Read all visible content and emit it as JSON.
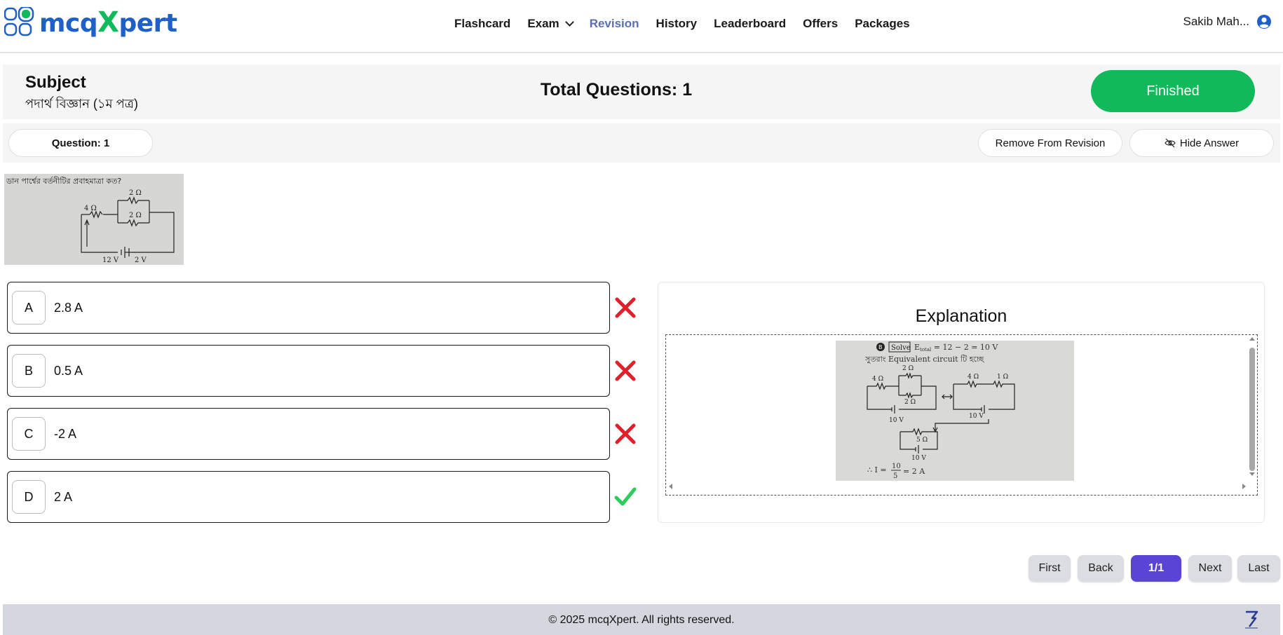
{
  "header": {
    "logo_text_1": "mcq",
    "logo_text_x": "X",
    "logo_text_2": "pert",
    "nav": [
      {
        "label": "Flashcard"
      },
      {
        "label": "Exam"
      },
      {
        "label": "Revision"
      },
      {
        "label": "History"
      },
      {
        "label": "Leaderboard"
      },
      {
        "label": "Offers"
      },
      {
        "label": "Packages"
      }
    ],
    "active_nav": "Revision",
    "user_name": "Sakib Mah..."
  },
  "subject": {
    "title": "Subject",
    "name": "পদার্থ বিজ্ঞান (১ম পত্র)",
    "total_questions": "Total Questions: 1",
    "finished_label": "Finished"
  },
  "question_bar": {
    "question_label": "Question: 1",
    "remove_label": "Remove From Revision",
    "hide_label": "Hide Answer"
  },
  "question_image": {
    "text": "ডান পার্শ্বের বর্তনীটির প্রবাহমাত্রা কত?",
    "r_top": "2 Ω",
    "r_left": "4 Ω",
    "r_bottom": "2 Ω",
    "v1": "12 V",
    "v2": "2 V"
  },
  "options": [
    {
      "letter": "A",
      "text": "2.8 A",
      "status": "wrong"
    },
    {
      "letter": "B",
      "text": "0.5 A",
      "status": "wrong"
    },
    {
      "letter": "C",
      "text": "-2 A",
      "status": "wrong"
    },
    {
      "letter": "D",
      "text": "2 A",
      "status": "correct"
    }
  ],
  "explanation": {
    "title": "Explanation",
    "line1_badge": "B",
    "line1_solve": "Solve",
    "line1_eq": "E",
    "line1_sub": "total",
    "line1_rest": " = 12 − 2 = 10 V",
    "line2": "সুতরাং Equivalent circuit টি হচ্ছে",
    "r_a": "2 Ω",
    "r_b": "4 Ω",
    "r_c": "2 Ω",
    "r_d": "4 Ω",
    "r_e": "1 Ω",
    "r_f": "5 Ω",
    "v_a": "10 V",
    "v_b": "10 V",
    "v_c": "10 V",
    "result_prefix": "∴ I = ",
    "result_num": "10",
    "result_den": "5",
    "result_val": "= 2 A"
  },
  "pagination": {
    "first": "First",
    "back": "Back",
    "current": "1/1",
    "next": "Next",
    "last": "Last"
  },
  "footer": {
    "copyright": "© 2025 mcqXpert. All rights reserved."
  },
  "colors": {
    "brand_blue": "#1e5fc8",
    "brand_green": "#12b95b",
    "wrong_red": "#e0202a",
    "correct_green": "#2ecc5a",
    "pager_active": "#5a44d6"
  }
}
